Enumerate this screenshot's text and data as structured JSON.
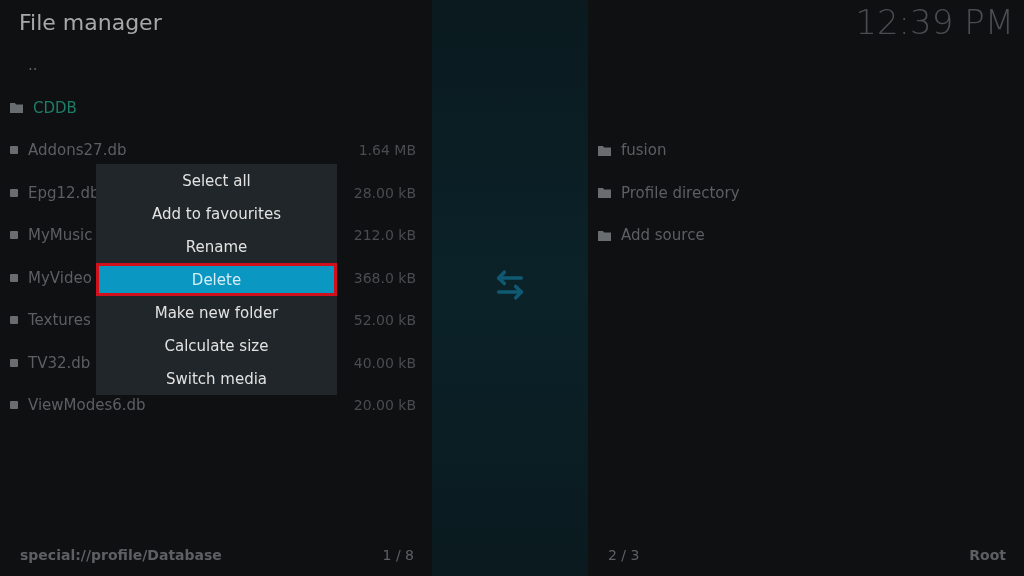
{
  "title": "File manager",
  "clock": "12:39 PM",
  "left_panel": {
    "rows": [
      {
        "name": "..",
        "kind": "parent",
        "size": "",
        "selected": false
      },
      {
        "name": "CDDB",
        "kind": "folder",
        "selected": true
      },
      {
        "name": "Addons27.db",
        "kind": "file",
        "size": "1.64 MB",
        "selected": false
      },
      {
        "name": "Epg12.db",
        "kind": "file",
        "size": "28.00 kB",
        "selected": false
      },
      {
        "name": "MyMusic",
        "kind": "file",
        "size": "212.0 kB",
        "selected": false
      },
      {
        "name": "MyVideo",
        "kind": "file",
        "size": "368.0 kB",
        "selected": false
      },
      {
        "name": "Textures",
        "kind": "file",
        "size": "52.00 kB",
        "selected": false
      },
      {
        "name": "TV32.db",
        "kind": "file",
        "size": "40.00 kB",
        "selected": false
      },
      {
        "name": "ViewModes6.db",
        "kind": "file",
        "size": "20.00 kB",
        "selected": false
      }
    ],
    "path": "special://profile/Database",
    "count": "1 / 8"
  },
  "right_panel": {
    "rows": [
      {
        "name": "fusion",
        "kind": "folder"
      },
      {
        "name": "Profile directory",
        "kind": "folder"
      },
      {
        "name": "Add source",
        "kind": "folder"
      }
    ],
    "count": "2 / 3",
    "location": "Root"
  },
  "context_menu": [
    {
      "label": "Select all",
      "selected": false
    },
    {
      "label": "Add to favourites",
      "selected": false
    },
    {
      "label": "Rename",
      "selected": false
    },
    {
      "label": "Delete",
      "selected": true
    },
    {
      "label": "Make new folder",
      "selected": false
    },
    {
      "label": "Calculate size",
      "selected": false
    },
    {
      "label": "Switch media",
      "selected": false
    }
  ]
}
